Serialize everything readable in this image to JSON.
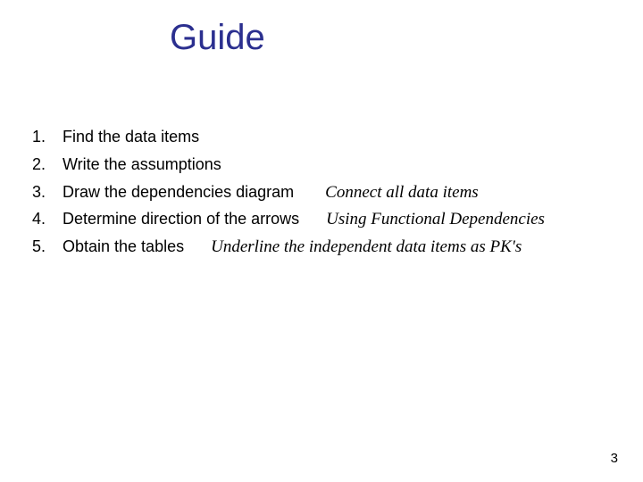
{
  "title": "Guide",
  "items": [
    {
      "num": "1.",
      "text": "Find the data items",
      "note": ""
    },
    {
      "num": "2.",
      "text": "Write the assumptions",
      "note": ""
    },
    {
      "num": "3.",
      "text": "Draw the dependencies diagram       ",
      "note": "Connect all data items"
    },
    {
      "num": "4.",
      "text": "Determine direction of the arrows      ",
      "note": "Using Functional Dependencies"
    },
    {
      "num": "5.",
      "text": "Obtain the tables      ",
      "note": "Underline the independent data items as PK's"
    }
  ],
  "page_number": "3"
}
